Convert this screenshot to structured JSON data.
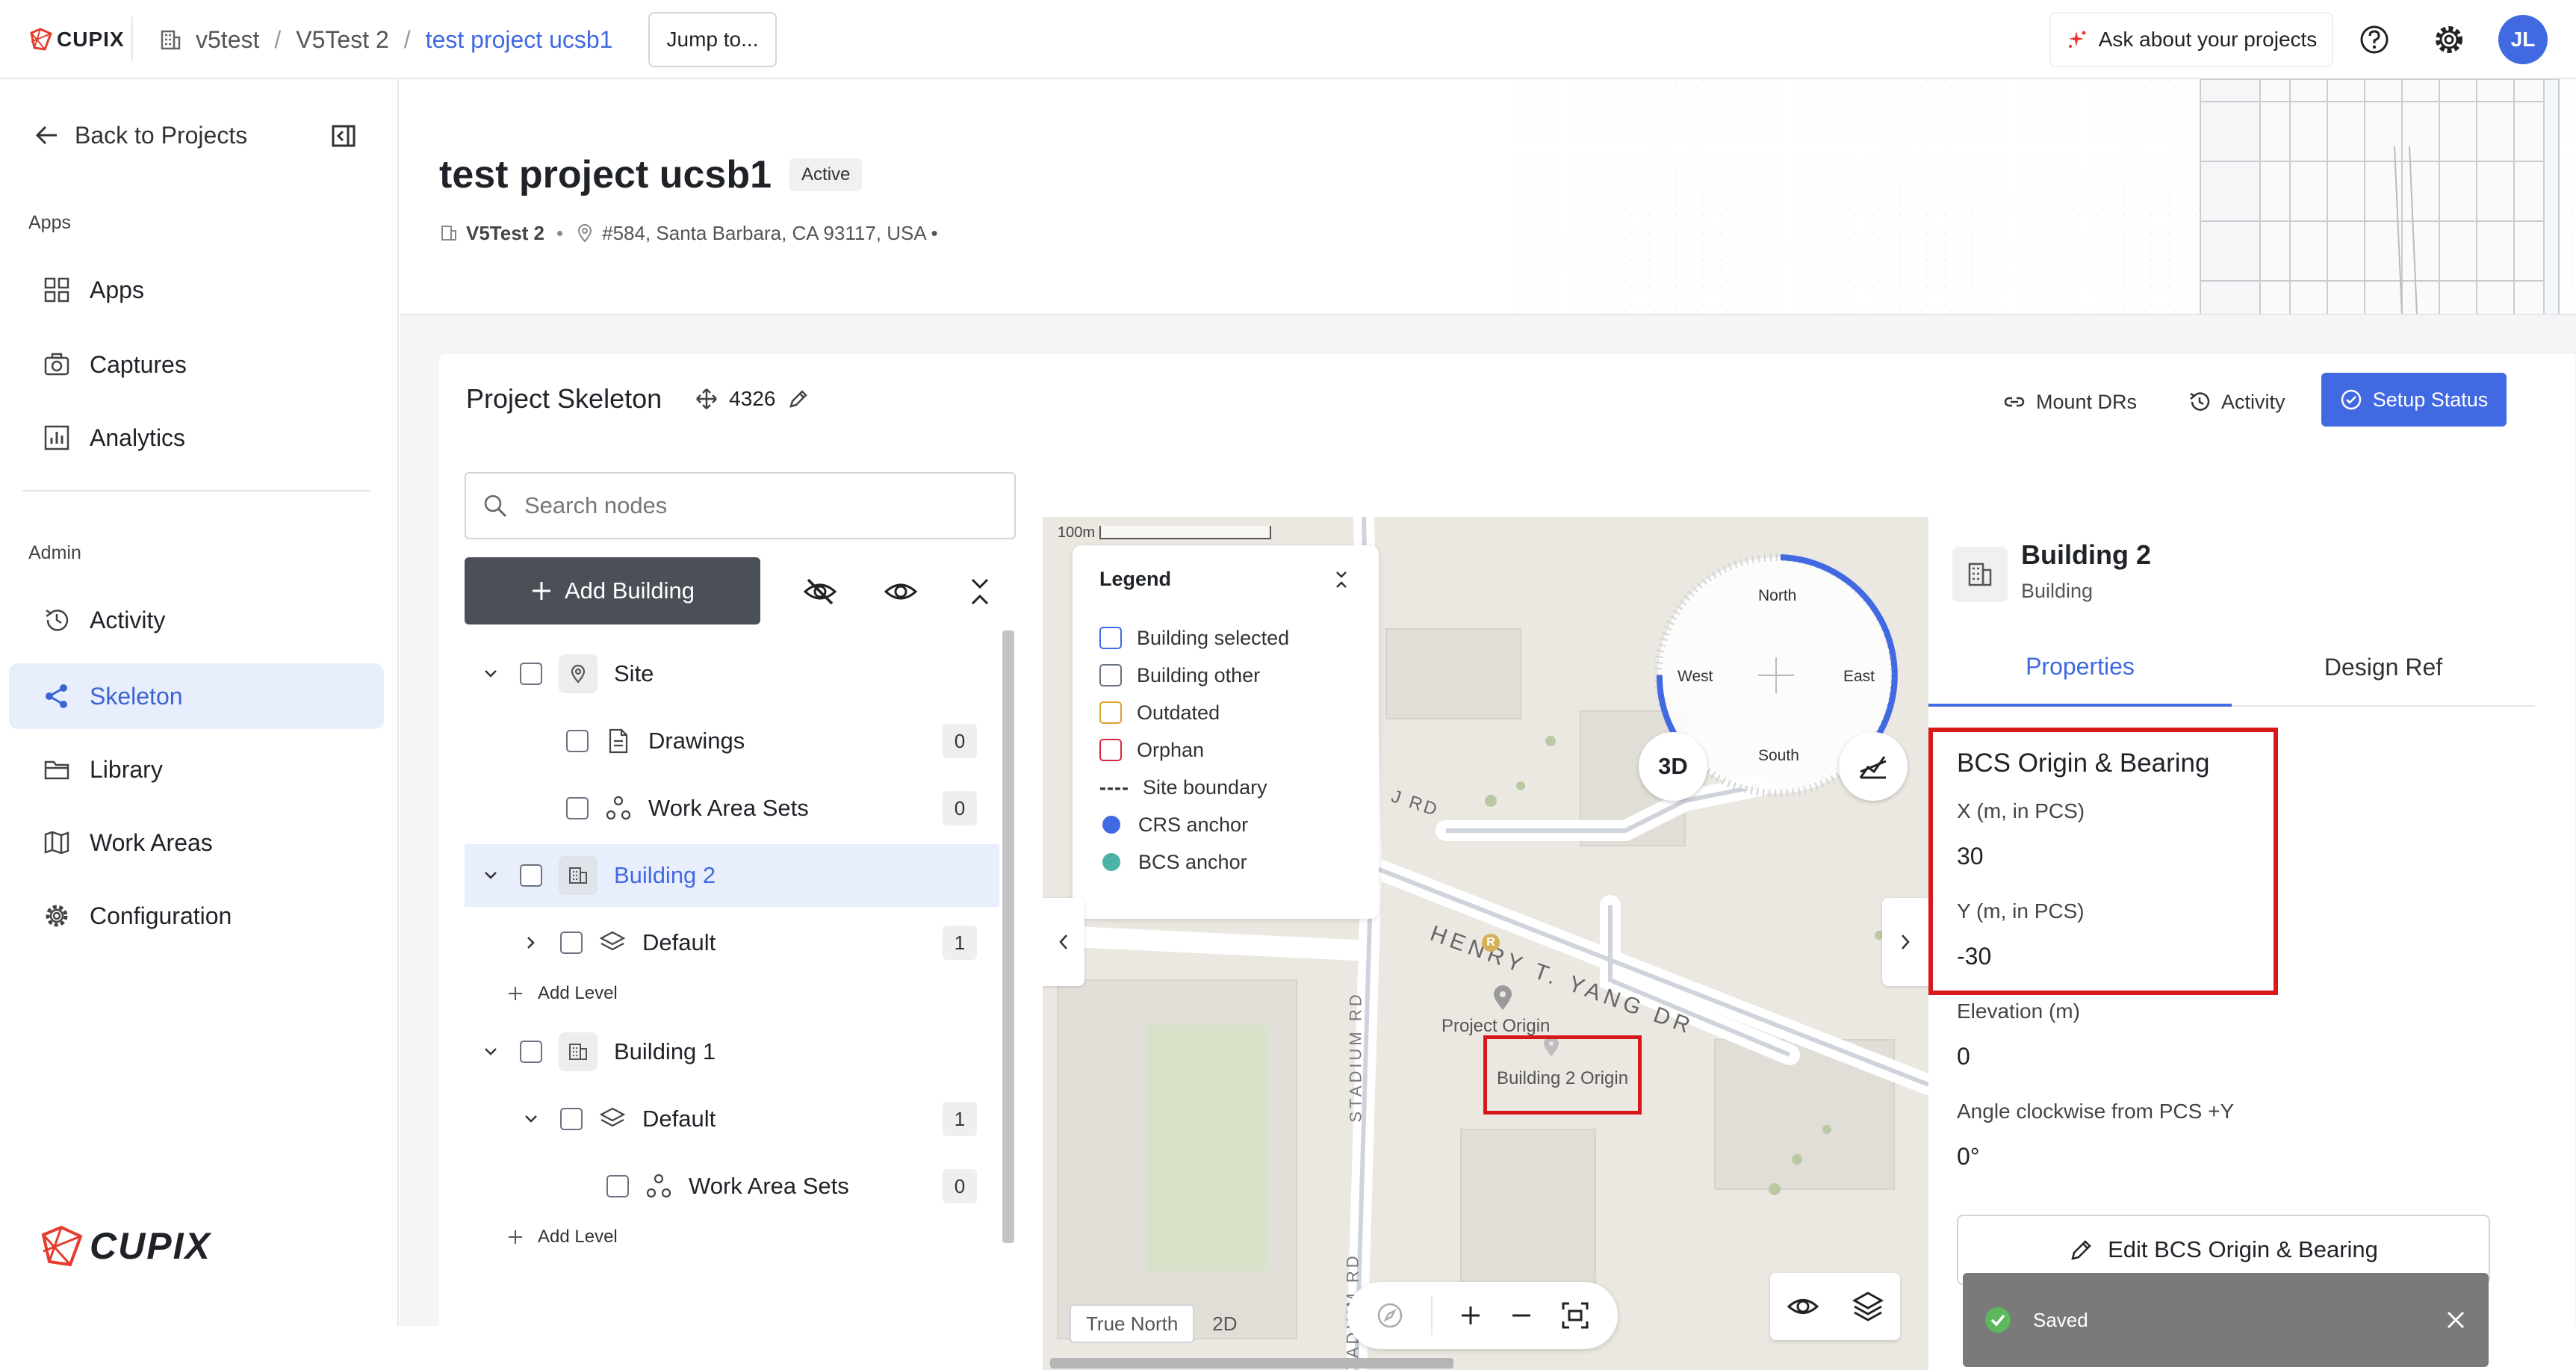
{
  "colors": {
    "accent": "#4169e1",
    "active_bg": "#e8eefb",
    "highlight_red": "#d7191c",
    "toast_bg": "#7a7a7a",
    "bcs_anchor": "#4bb3a6"
  },
  "topbar": {
    "logo_text": "CUPIX",
    "breadcrumb": [
      "v5test",
      "V5Test 2",
      "test project ucsb1"
    ],
    "breadcrumb_sep": "/",
    "jump_label": "Jump to...",
    "ask_label": "Ask about your projects",
    "avatar_initials": "JL"
  },
  "sidebar": {
    "back_label": "Back to Projects",
    "apps_section": "Apps",
    "apps_items": [
      {
        "label": "Apps",
        "icon": "grid-icon"
      },
      {
        "label": "Captures",
        "icon": "camera-icon"
      },
      {
        "label": "Analytics",
        "icon": "chart-icon"
      }
    ],
    "admin_section": "Admin",
    "admin_items": [
      {
        "label": "Activity",
        "icon": "history-icon"
      },
      {
        "label": "Skeleton",
        "icon": "skeleton-icon"
      },
      {
        "label": "Library",
        "icon": "folder-icon"
      },
      {
        "label": "Work Areas",
        "icon": "map-icon"
      },
      {
        "label": "Configuration",
        "icon": "gear-icon"
      }
    ],
    "footer_logo": "CUPIX"
  },
  "project": {
    "title": "test project ucsb1",
    "status": "Active",
    "org": "V5Test 2",
    "address": "#584, Santa Barbara, CA 93117, USA •",
    "dot": "•"
  },
  "skeleton": {
    "title": "Project Skeleton",
    "crs": "4326",
    "mount_label": "Mount DRs",
    "activity_label": "Activity",
    "setup_label": "Setup Status",
    "search_placeholder": "Search nodes",
    "add_building_label": "Add Building",
    "tree": [
      {
        "label": "Site",
        "count": ""
      },
      {
        "label": "Drawings",
        "count": "0"
      },
      {
        "label": "Work Area Sets",
        "count": "0"
      },
      {
        "label": "Building 2",
        "count": ""
      },
      {
        "label": "Default",
        "count": "1"
      },
      {
        "label": "Add Level",
        "count": ""
      },
      {
        "label": "Building 1",
        "count": ""
      },
      {
        "label": "Default",
        "count": "1"
      },
      {
        "label": "Work Area Sets",
        "count": "0"
      },
      {
        "label": "Add Level",
        "count": ""
      }
    ]
  },
  "map": {
    "scale_label": "100m",
    "legend_title": "Legend",
    "legend": [
      {
        "label": "Building selected",
        "color": "#4169e1"
      },
      {
        "label": "Building other",
        "color": "#6b7280"
      },
      {
        "label": "Outdated",
        "color": "#e0a030"
      },
      {
        "label": "Orphan",
        "color": "#d7263d"
      },
      {
        "label": "Site boundary",
        "color": "#333333"
      },
      {
        "label": "CRS anchor",
        "color": "#4169e1"
      },
      {
        "label": "BCS anchor",
        "color": "#4bb3a6"
      }
    ],
    "dash": "----",
    "compass": {
      "n": "North",
      "s": "South",
      "e": "East",
      "w": "West"
    },
    "btn_3d": "3D",
    "street_1": "J RD",
    "street_2": "HENRY T. YANG DR",
    "street_3": "STADIUM RD",
    "street_4": "STADIUM RD",
    "project_origin": "Project Origin",
    "building_origin": "Building 2 Origin",
    "true_north": "True North",
    "mode_2d": "2D"
  },
  "panel": {
    "title": "Building 2",
    "subtitle": "Building",
    "tab_properties": "Properties",
    "tab_design": "Design Ref",
    "section_title": "BCS Origin & Bearing",
    "props": [
      {
        "label": "X (m, in PCS)",
        "value": "30"
      },
      {
        "label": "Y (m, in PCS)",
        "value": "-30"
      },
      {
        "label": "Elevation (m)",
        "value": "0"
      },
      {
        "label": "Angle clockwise from PCS +Y",
        "value": "0°"
      }
    ],
    "edit_label": "Edit BCS Origin & Bearing"
  },
  "toast": {
    "label": "Saved"
  }
}
